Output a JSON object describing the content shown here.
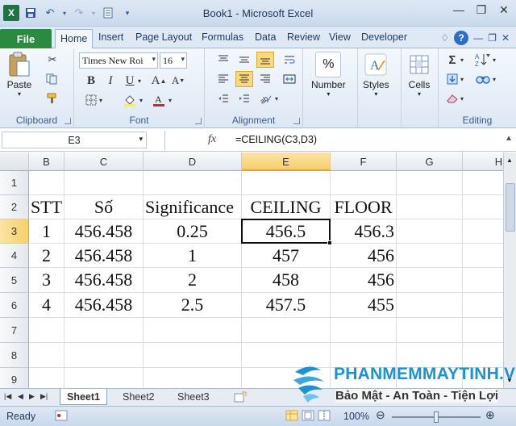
{
  "window": {
    "title": "Book1 - Microsoft Excel"
  },
  "ribbon_tabs": {
    "file": "File",
    "tabs": [
      "Home",
      "Insert",
      "Page Layout",
      "Formulas",
      "Data",
      "Review",
      "View",
      "Developer"
    ]
  },
  "clipboard": {
    "paste_label": "Paste",
    "group_label": "Clipboard"
  },
  "font": {
    "family": "Times New Roi",
    "size": "16",
    "group_label": "Font"
  },
  "alignment": {
    "group_label": "Alignment"
  },
  "number": {
    "label": "Number",
    "icon_text": "%"
  },
  "styles": {
    "label": "Styles"
  },
  "cells": {
    "label": "Cells"
  },
  "editing": {
    "group_label": "Editing"
  },
  "formula_bar": {
    "name_box": "E3",
    "fx": "fx",
    "formula": "=CEILING(C3,D3)"
  },
  "columns": [
    "B",
    "C",
    "D",
    "E",
    "F",
    "G",
    "H"
  ],
  "rows": [
    "1",
    "2",
    "3",
    "4",
    "5",
    "6",
    "7",
    "8",
    "9"
  ],
  "table": {
    "headers": [
      "STT",
      "Số",
      "Significance",
      "CEILING",
      "FLOOR"
    ],
    "rows": [
      [
        "1",
        "456.458",
        "0.25",
        "456.5",
        "456.3"
      ],
      [
        "2",
        "456.458",
        "1",
        "457",
        "456"
      ],
      [
        "3",
        "456.458",
        "2",
        "458",
        "456"
      ],
      [
        "4",
        "456.458",
        "2.5",
        "457.5",
        "455"
      ]
    ]
  },
  "sheets": [
    "Sheet1",
    "Sheet2",
    "Sheet3"
  ],
  "status": {
    "ready": "Ready",
    "zoom": "100%"
  },
  "watermark": {
    "title": "PHANMEMMAYTINH.VN",
    "subtitle": "Bảo Mật - An Toàn - Tiện Lợi"
  },
  "colors": {
    "file_tab": "#2a8a3e",
    "active_header": "#f7cf6b",
    "watermark_blue": "#1c92d2"
  }
}
